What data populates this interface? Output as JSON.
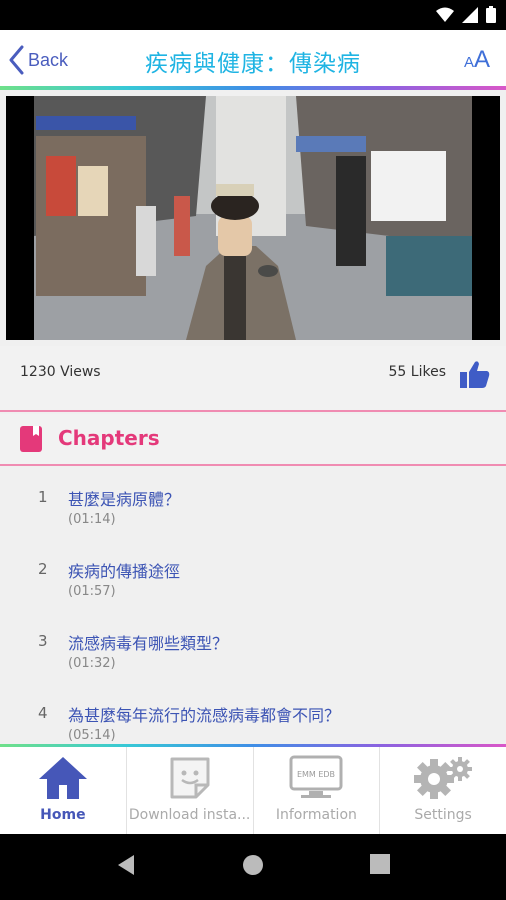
{
  "header": {
    "back_label": "Back",
    "title": "疾病與健康：傳染病",
    "font_small": "A",
    "font_big": "A"
  },
  "stats": {
    "views": "1230 Views",
    "likes": "55 Likes"
  },
  "chapters": {
    "heading": "Chapters",
    "items": [
      {
        "num": "1",
        "title": "甚麼是病原體？",
        "time": "(01:14)"
      },
      {
        "num": "2",
        "title": "疾病的傳播途徑",
        "time": "(01:57)"
      },
      {
        "num": "3",
        "title": "流感病毒有哪些類型？",
        "time": "(01:32)"
      },
      {
        "num": "4",
        "title": "為甚麼每年流行的流感病毒都會不同？",
        "time": "(05:14)"
      }
    ]
  },
  "tabs": [
    {
      "label": "Home",
      "icon": "home-icon"
    },
    {
      "label": "Download insta...",
      "icon": "sticker-icon"
    },
    {
      "label": "Information",
      "icon": "monitor-icon",
      "screen_text": "EMM EDB"
    },
    {
      "label": "Settings",
      "icon": "gears-icon"
    }
  ],
  "colors": {
    "accent_blue": "#4657b8",
    "title_cyan": "#1fb4e3",
    "chapter_pink": "#e4397a"
  }
}
